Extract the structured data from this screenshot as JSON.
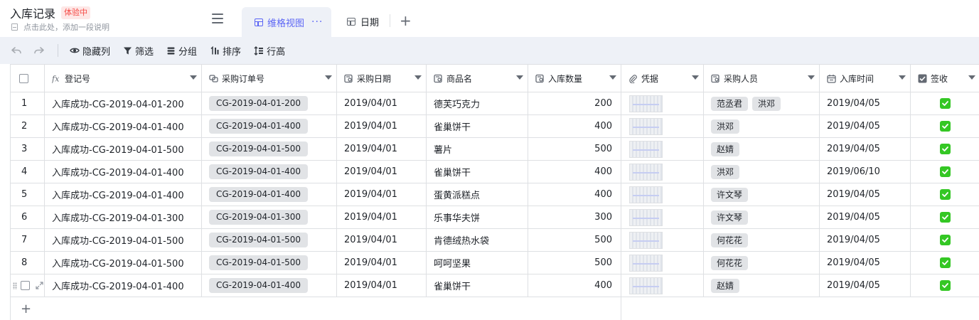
{
  "header": {
    "title": "入库记录",
    "badge": "体验中",
    "description": "点击此处，添加一段说明"
  },
  "tabs": [
    {
      "label": "维格视图",
      "active": true,
      "more": "···"
    },
    {
      "label": "日期",
      "active": false
    }
  ],
  "add_tab_label": "+",
  "toolbar": {
    "hide_columns": "隐藏列",
    "filter": "筛选",
    "group": "分组",
    "sort": "排序",
    "row_height": "行高"
  },
  "columns": [
    {
      "label": "登记号",
      "icon": "formula-icon"
    },
    {
      "label": "采购订单号",
      "icon": "link-icon"
    },
    {
      "label": "采购日期",
      "icon": "lookup-icon"
    },
    {
      "label": "商品名",
      "icon": "lookup-icon"
    },
    {
      "label": "入库数量",
      "icon": "lookup-icon"
    },
    {
      "label": "凭据",
      "icon": "attachment-icon"
    },
    {
      "label": "采购人员",
      "icon": "lookup-icon"
    },
    {
      "label": "入库时间",
      "icon": "calendar-icon"
    },
    {
      "label": "签收",
      "icon": "checkbox-icon"
    }
  ],
  "rows": [
    {
      "num": "1",
      "reg": "入库成功-CG-2019-04-01-200",
      "order": "CG-2019-04-01-200",
      "pdate": "2019/04/01",
      "product": "德芙巧克力",
      "qty": "200",
      "people": [
        "范丞君",
        "洪邓"
      ],
      "indate": "2019/04/05",
      "signed": true
    },
    {
      "num": "2",
      "reg": "入库成功-CG-2019-04-01-400",
      "order": "CG-2019-04-01-400",
      "pdate": "2019/04/01",
      "product": "雀巢饼干",
      "qty": "400",
      "people": [
        "洪邓"
      ],
      "indate": "2019/04/05",
      "signed": true
    },
    {
      "num": "3",
      "reg": "入库成功-CG-2019-04-01-500",
      "order": "CG-2019-04-01-500",
      "pdate": "2019/04/01",
      "product": "薯片",
      "qty": "500",
      "people": [
        "赵婧"
      ],
      "indate": "2019/04/05",
      "signed": true
    },
    {
      "num": "4",
      "reg": "入库成功-CG-2019-04-01-400",
      "order": "CG-2019-04-01-400",
      "pdate": "2019/04/01",
      "product": "雀巢饼干",
      "qty": "400",
      "people": [
        "洪邓"
      ],
      "indate": "2019/06/10",
      "signed": true
    },
    {
      "num": "5",
      "reg": "入库成功-CG-2019-04-01-400",
      "order": "CG-2019-04-01-400",
      "pdate": "2019/04/01",
      "product": "蛋黄派糕点",
      "qty": "400",
      "people": [
        "许文琴"
      ],
      "indate": "2019/04/05",
      "signed": true
    },
    {
      "num": "6",
      "reg": "入库成功-CG-2019-04-01-300",
      "order": "CG-2019-04-01-300",
      "pdate": "2019/04/01",
      "product": "乐事华夫饼",
      "qty": "300",
      "people": [
        "许文琴"
      ],
      "indate": "2019/04/05",
      "signed": true
    },
    {
      "num": "7",
      "reg": "入库成功-CG-2019-04-01-500",
      "order": "CG-2019-04-01-500",
      "pdate": "2019/04/01",
      "product": "肯德绒热水袋",
      "qty": "500",
      "people": [
        "何花花"
      ],
      "indate": "2019/04/05",
      "signed": true
    },
    {
      "num": "8",
      "reg": "入库成功-CG-2019-04-01-500",
      "order": "CG-2019-04-01-500",
      "pdate": "2019/04/01",
      "product": "呵呵坚果",
      "qty": "500",
      "people": [
        "何花花"
      ],
      "indate": "2019/04/05",
      "signed": true
    },
    {
      "num": "",
      "reg": "入库成功-CG-2019-04-01-400",
      "order": "CG-2019-04-01-400",
      "pdate": "2019/04/01",
      "product": "雀巢饼干",
      "qty": "400",
      "people": [
        "赵婧"
      ],
      "indate": "2019/04/05",
      "signed": true,
      "hovered": true
    }
  ],
  "add_row_label": "+",
  "colors": {
    "accent": "#5b65f5",
    "toolbar_bg": "#eef1f7",
    "chip_bg": "#e1e3e6",
    "check_green": "#34c724",
    "badge_text": "#f54a45",
    "badge_bg": "#fee7e6"
  }
}
